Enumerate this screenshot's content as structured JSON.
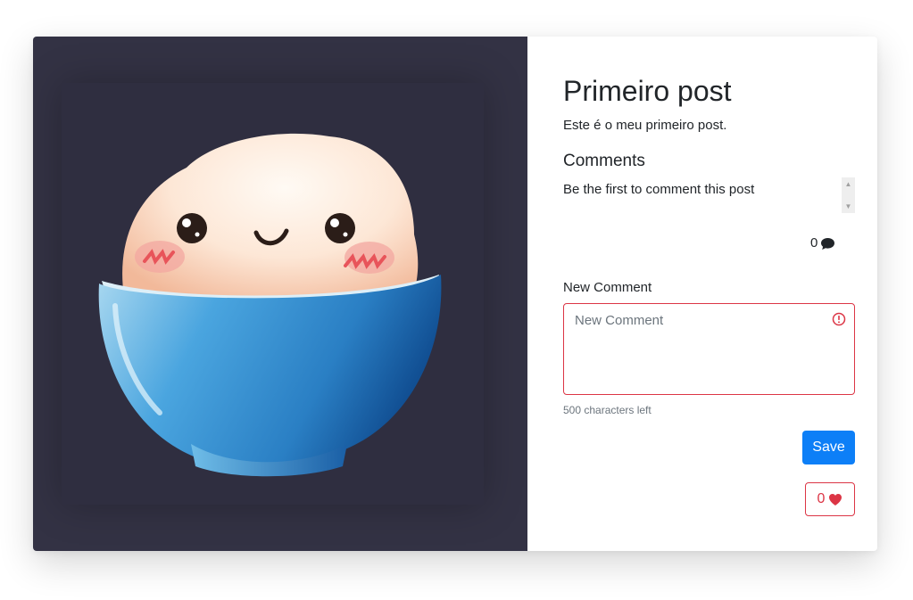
{
  "post": {
    "title": "Primeiro post",
    "body": "Este é o meu primeiro post.",
    "image_alt": "rice bowl illustration"
  },
  "comments": {
    "heading": "Comments",
    "empty_message": "Be the first to comment this post",
    "count": "0",
    "count_icon": "comment-icon"
  },
  "new_comment": {
    "label": "New Comment",
    "placeholder": "New Comment",
    "value": "",
    "chars_left": "500 characters left",
    "invalid_icon": "exclamation-circle-icon"
  },
  "actions": {
    "save_label": "Save",
    "like_count": "0",
    "like_icon": "heart-icon"
  },
  "colors": {
    "image_background": "#333244",
    "primary": "#0d7ff7",
    "danger": "#dc3545",
    "muted": "#6c757d"
  }
}
